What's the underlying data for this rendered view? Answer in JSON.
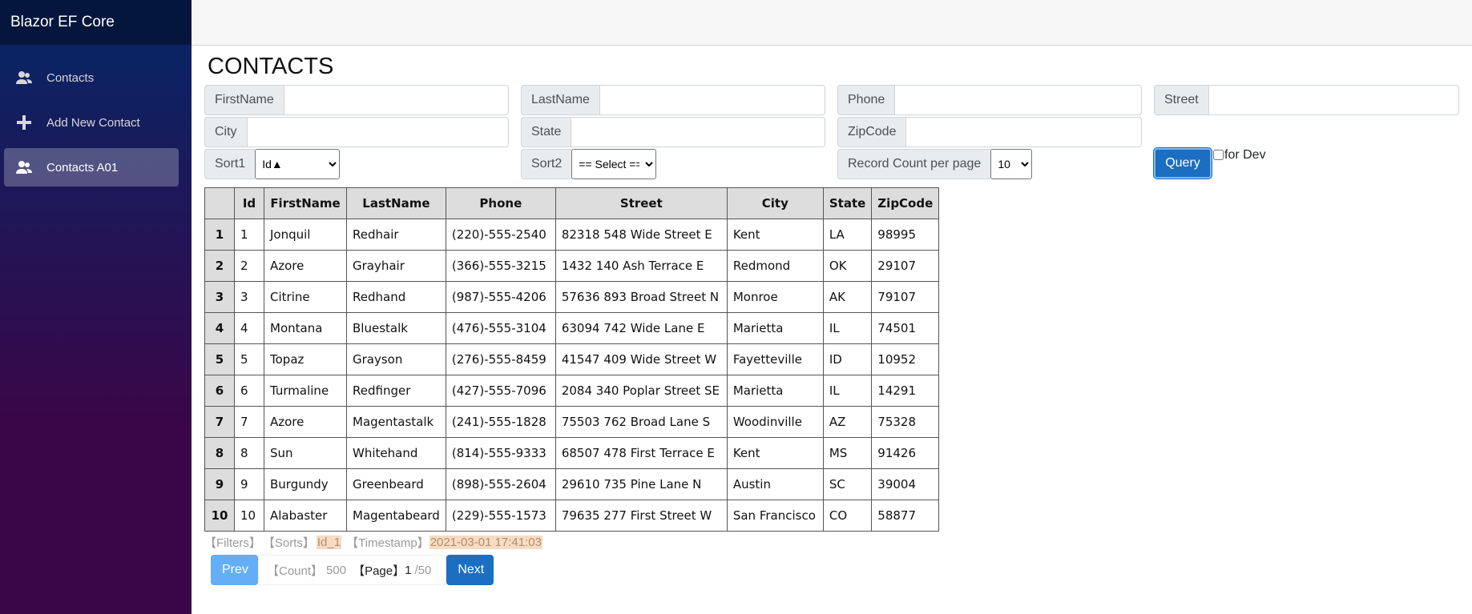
{
  "app": {
    "title": "Blazor EF Core"
  },
  "sidebar": {
    "items": [
      {
        "label": "Contacts",
        "icon": "people-icon"
      },
      {
        "label": "Add New Contact",
        "icon": "plus-icon"
      },
      {
        "label": "Contacts A01",
        "icon": "people-icon",
        "active": true
      }
    ]
  },
  "page": {
    "title": "CONTACTS"
  },
  "filters": {
    "firstname": {
      "label": "FirstName",
      "value": ""
    },
    "lastname": {
      "label": "LastName",
      "value": ""
    },
    "phone": {
      "label": "Phone",
      "value": ""
    },
    "street": {
      "label": "Street",
      "value": ""
    },
    "city": {
      "label": "City",
      "value": ""
    },
    "state": {
      "label": "State",
      "value": ""
    },
    "zipcode": {
      "label": "ZipCode",
      "value": ""
    },
    "sort1": {
      "label": "Sort1",
      "value": "Id▲"
    },
    "sort2": {
      "label": "Sort2",
      "value": "== Select =="
    },
    "record_count": {
      "label": "Record Count per page",
      "value": "10"
    }
  },
  "query_button": "Query",
  "dev_checkbox": {
    "label": "for Dev",
    "checked": false
  },
  "table": {
    "columns": [
      "",
      "Id",
      "FirstName",
      "LastName",
      "Phone",
      "Street",
      "City",
      "State",
      "ZipCode"
    ],
    "rows": [
      [
        "1",
        "1",
        "Jonquil",
        "Redhair",
        "(220)-555-2540",
        "82318 548 Wide Street E",
        "Kent",
        "LA",
        "98995"
      ],
      [
        "2",
        "2",
        "Azore",
        "Grayhair",
        "(366)-555-3215",
        "1432 140 Ash Terrace E",
        "Redmond",
        "OK",
        "29107"
      ],
      [
        "3",
        "3",
        "Citrine",
        "Redhand",
        "(987)-555-4206",
        "57636 893 Broad Street N",
        "Monroe",
        "AK",
        "79107"
      ],
      [
        "4",
        "4",
        "Montana",
        "Bluestalk",
        "(476)-555-3104",
        "63094 742 Wide Lane E",
        "Marietta",
        "IL",
        "74501"
      ],
      [
        "5",
        "5",
        "Topaz",
        "Grayson",
        "(276)-555-8459",
        "41547 409 Wide Street W",
        "Fayetteville",
        "ID",
        "10952"
      ],
      [
        "6",
        "6",
        "Turmaline",
        "Redfinger",
        "(427)-555-7096",
        "2084 340 Poplar Street SE",
        "Marietta",
        "IL",
        "14291"
      ],
      [
        "7",
        "7",
        "Azore",
        "Magentastalk",
        "(241)-555-1828",
        "75503 762 Broad Lane S",
        "Woodinville",
        "AZ",
        "75328"
      ],
      [
        "8",
        "8",
        "Sun",
        "Whitehand",
        "(814)-555-9333",
        "68507 478 First Terrace E",
        "Kent",
        "MS",
        "91426"
      ],
      [
        "9",
        "9",
        "Burgundy",
        "Greenbeard",
        "(898)-555-2604",
        "29610 735 Pine Lane N",
        "Austin",
        "SC",
        "39004"
      ],
      [
        "10",
        "10",
        "Alabaster",
        "Magentabeard",
        "(229)-555-1573",
        "79635 277 First Street W",
        "San Francisco",
        "CO",
        "58877"
      ]
    ]
  },
  "status": {
    "filters_label": "【Filters】",
    "sorts_label": "【Sorts】",
    "sorts_value": "Id_1",
    "timestamp_label": "【Timestamp】",
    "timestamp_value": "2021-03-01 17:41:03"
  },
  "pager": {
    "prev": "Prev",
    "next": "Next",
    "count_label": "【Count】",
    "count_value": "500",
    "page_label": "【Page】",
    "page_value": "1",
    "page_total": "/50"
  }
}
